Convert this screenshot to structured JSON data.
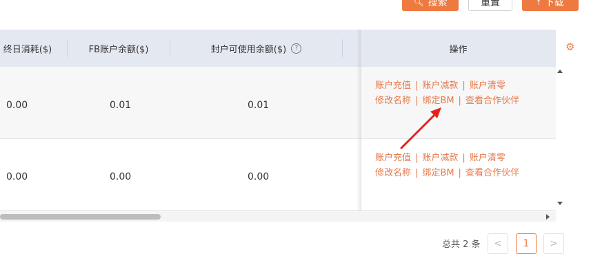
{
  "toolbar": {
    "search_label": "搜索",
    "reset_label": "重置",
    "download_label": "下载"
  },
  "table": {
    "headers": {
      "daily_spend": "终日消耗($)",
      "fb_balance": "FB账户余额($)",
      "capped_balance": "封户可使用余额($)",
      "operation": "操作"
    },
    "rows": [
      {
        "daily_spend": "0.00",
        "fb_balance": "0.01",
        "capped_balance": "0.01"
      },
      {
        "daily_spend": "0.00",
        "fb_balance": "0.00",
        "capped_balance": "0.00"
      }
    ],
    "actions": {
      "recharge": "账户充值",
      "deduct": "账户减款",
      "clear": "账户清零",
      "rename": "修改名称",
      "bind_bm": "绑定BM",
      "partners": "查看合作伙伴"
    }
  },
  "pagination": {
    "total_text": "总共 2 条",
    "current_page": "1",
    "prev": "<",
    "next": ">"
  },
  "colors": {
    "accent": "#ee7a41",
    "link": "#e47a4c",
    "header_bg": "#e4e8f0",
    "annotation_arrow": "#e8221b"
  }
}
